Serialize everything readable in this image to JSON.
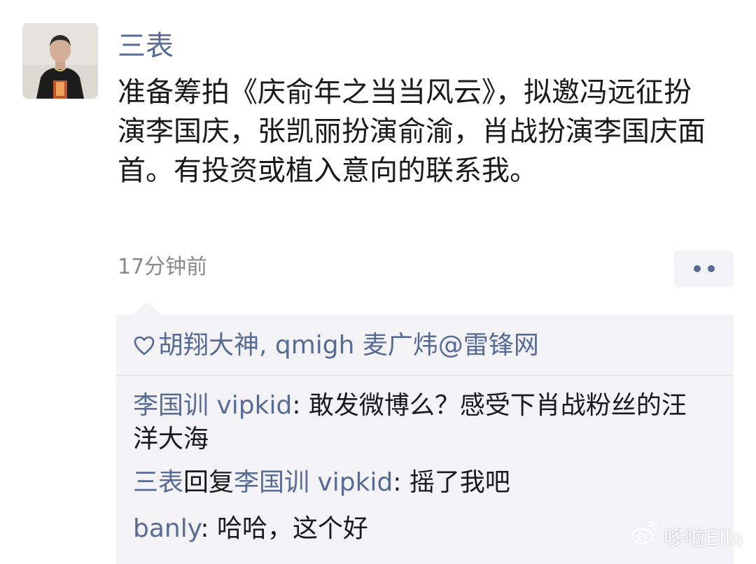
{
  "post": {
    "author": "三表",
    "text": "准备筹拍《庆俞年之当当风云》，拟邀冯远征扮演李国庆，张凯丽扮演俞渝，肖战扮演李国庆面首。有投资或植入意向的联系我。",
    "timestamp": "17分钟前",
    "more_icon": "more-dots-icon"
  },
  "likes": {
    "icon": "heart-outline-icon",
    "names": "胡翔大神, qmigh 麦广炜@雷锋网"
  },
  "comments": [
    {
      "author": "李国训 vipkid",
      "separator": ": ",
      "text": "敢发微博么？感受下肖战粉丝的汪洋大海"
    },
    {
      "author": "三表",
      "reply_word": "回复",
      "reply_to": "李国训 vipkid",
      "separator": ": ",
      "text": "摇了我吧"
    },
    {
      "author": "banly",
      "separator": ": ",
      "text": "哈哈，这个好"
    }
  ],
  "watermark": {
    "icon": "weibo-logo-icon",
    "text": "哆啦Ella"
  },
  "colors": {
    "link": "#576b95",
    "body_text": "#1a1a1a",
    "meta_text": "#8a8a8a",
    "panel_bg": "#f3f3f5"
  }
}
